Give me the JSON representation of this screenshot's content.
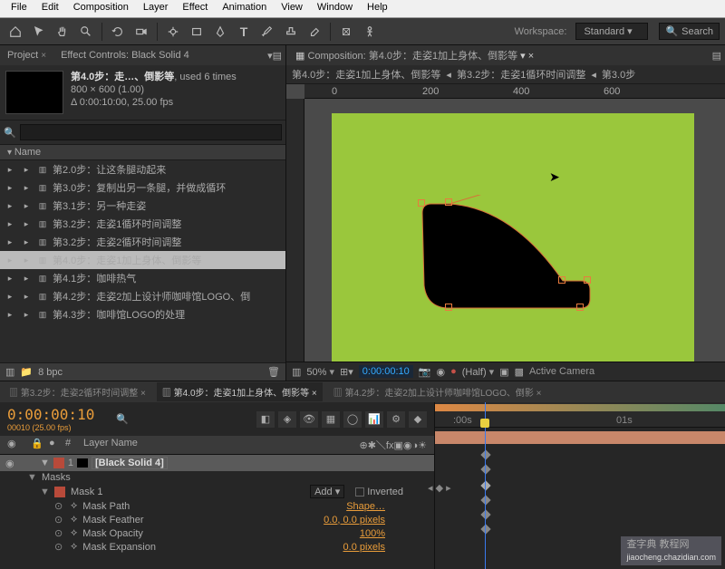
{
  "menu": [
    "File",
    "Edit",
    "Composition",
    "Layer",
    "Effect",
    "Animation",
    "View",
    "Window",
    "Help"
  ],
  "workspace": {
    "label": "Workspace:",
    "value": "Standard",
    "search": "Search"
  },
  "panels": {
    "project": "Project",
    "effectControls": "Effect Controls: Black Solid 4"
  },
  "project": {
    "title": "第4.0步：走…、倒影等",
    "usage": ", used 6 times",
    "dims": "800 × 600 (1.00)",
    "duration": "Δ 0:00:10:00, 25.00 fps",
    "nameCol": "Name",
    "items": [
      "第2.0步：让这条腿动起来",
      "第3.0步：复制出另一条腿，并做成循环",
      "第3.1步：另一种走姿",
      "第3.2步：走姿1循环时间调整",
      "第3.2步：走姿2循环时间调整",
      "第4.0步：走姿1加上身体、倒影等",
      "第4.1步：咖啡热气",
      "第4.2步：走姿2加上设计师咖啡馆LOGO、倒",
      "第4.3步：咖啡馆LOGO的处理"
    ],
    "selectedIndex": 5,
    "footer": "8 bpc"
  },
  "comp": {
    "tab": "Composition: 第4.0步：走姿1加上身体、倒影等",
    "crumbs": [
      "第4.0步：走姿1加上身体、倒影等",
      "第3.2步：走姿1循环时间调整",
      "第3.0步"
    ],
    "rulerMarks": [
      "0",
      "200",
      "400",
      "600"
    ],
    "footer": {
      "zoom": "50%",
      "tc": "0:00:00:10",
      "res": "(Half)",
      "camera": "Active Camera"
    }
  },
  "timeline": {
    "tabs": [
      "第3.2步：走姿2循环时间调整",
      "第4.0步：走姿1加上身体、倒影等",
      "第4.2步：走姿2加上设计师咖啡馆LOGO、倒影"
    ],
    "activeTab": 1,
    "timecode": "0:00:00:10",
    "sub": "00010 (25.00 fps)",
    "layerNameCol": "Layer Name",
    "layer": {
      "num": "1",
      "name": "[Black Solid 4]"
    },
    "masks": "Masks",
    "mask1": "Mask 1",
    "mode": "Add",
    "inverted": "Inverted",
    "props": [
      {
        "n": "Mask Path",
        "v": "Shape…"
      },
      {
        "n": "Mask Feather",
        "v": "0.0, 0.0 pixels"
      },
      {
        "n": "Mask Opacity",
        "v": "100%"
      },
      {
        "n": "Mask Expansion",
        "v": "0.0 pixels"
      }
    ],
    "ruler": [
      ":00s",
      "01s"
    ]
  },
  "watermark": {
    "a": "查字典 教程网",
    "b": "jiaocheng.chazidian.com"
  }
}
